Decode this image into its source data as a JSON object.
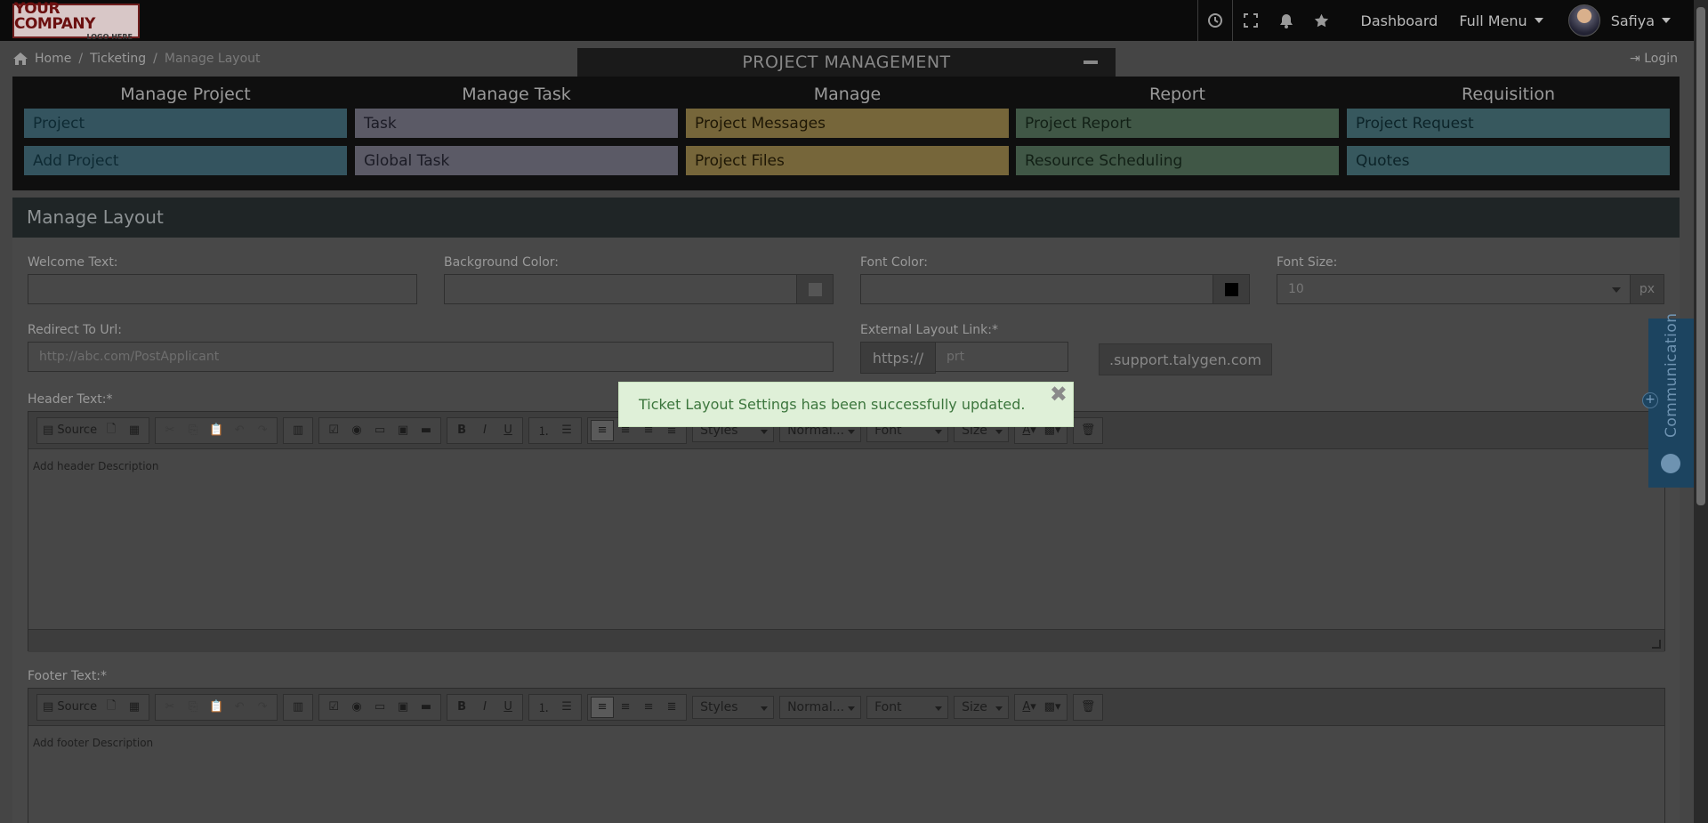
{
  "topbar": {
    "logo_line1": "YOUR COMPANY",
    "logo_line2": "LOGO HERE",
    "dashboard": "Dashboard",
    "full_menu": "Full Menu",
    "user_name": "Safiya"
  },
  "breadcrumb": {
    "home": "Home",
    "ticketing": "Ticketing",
    "current": "Manage Layout"
  },
  "login": "Login",
  "pm": {
    "title": "PROJECT MANAGEMENT",
    "columns": [
      {
        "header": "Manage Project",
        "items": [
          "Project",
          "Add Project"
        ]
      },
      {
        "header": "Manage Task",
        "items": [
          "Task",
          "Global Task"
        ]
      },
      {
        "header": "Manage",
        "items": [
          "Project Messages",
          "Project Files"
        ]
      },
      {
        "header": "Report",
        "items": [
          "Project Report",
          "Resource Scheduling"
        ]
      },
      {
        "header": "Requisition",
        "items": [
          "Project Request",
          "Quotes"
        ]
      }
    ]
  },
  "form": {
    "title": "Manage Layout",
    "welcome_label": "Welcome Text:",
    "bg_label": "Background Color:",
    "font_color_label": "Font Color:",
    "font_size_label": "Font Size:",
    "font_size_value": "10",
    "font_size_unit": "px",
    "redirect_label": "Redirect To Url:",
    "redirect_placeholder": "http://abc.com/PostApplicant",
    "external_label": "External Layout Link:*",
    "external_prefix": "https://",
    "external_value": "prt",
    "support_suffix": ".support.talygen.com",
    "header_label": "Header Text:*",
    "header_placeholder": "Add header Description",
    "footer_label": "Footer Text:*",
    "footer_placeholder": "Add footer Description"
  },
  "toolbar": {
    "source": "Source",
    "styles": "Styles",
    "format": "Normal...",
    "font": "Font",
    "size": "Size"
  },
  "communication": "Communication",
  "toast": {
    "message": "Ticket Layout Settings has been successfully updated."
  }
}
